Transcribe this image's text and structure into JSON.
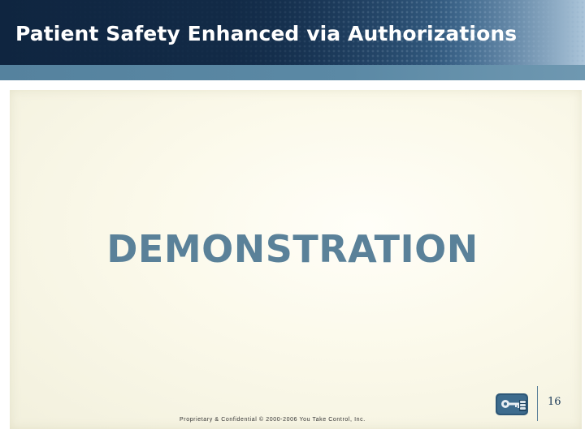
{
  "slide": {
    "title": "Patient Safety Enhanced via Authorizations",
    "heading": "DEMONSTRATION",
    "footer": "Proprietary & Confidential © 2000-2006 You Take Control, Inc.",
    "page_number": "16"
  },
  "logo": {
    "icon": "key-in-hand-icon"
  },
  "colors": {
    "header_dark": "#0f2540",
    "accent_bar": "#5b89a5",
    "heading": "#5a8199",
    "panel": "#fbf9ea"
  }
}
